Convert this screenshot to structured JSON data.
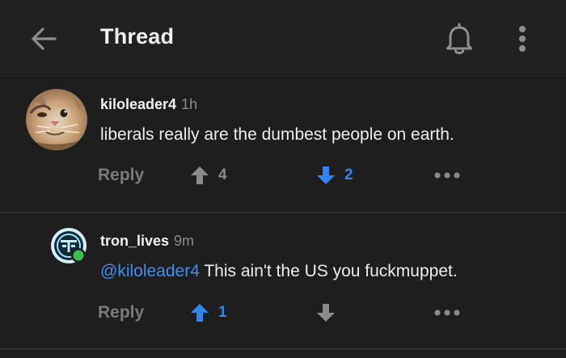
{
  "header": {
    "title": "Thread",
    "back_icon": "arrow-left-icon",
    "bell_icon": "bell-icon",
    "more_icon": "vertical-dots-icon"
  },
  "colors": {
    "background": "#1e1e1e",
    "text": "#ececec",
    "muted": "#8a8a8a",
    "accent_blue": "#2f86f0",
    "online_green": "#3bbf4c"
  },
  "comments": [
    {
      "username": "kiloleader4",
      "time": "1h",
      "text": "liberals really are the dumbest people on earth.",
      "reply_label": "Reply",
      "upvotes": "4",
      "upvote_active": false,
      "downvotes": "2",
      "downvote_active": true,
      "avatar": "cat-photo-avatar"
    },
    {
      "username": "tron_lives",
      "time": "9m",
      "mention": "@kiloleader4",
      "text": " This ain't the US you fuckmuppet.",
      "reply_label": "Reply",
      "upvotes": "1",
      "upvote_active": true,
      "downvotes": "",
      "downvote_active": false,
      "avatar": "tron-logo-avatar",
      "online": true
    }
  ]
}
